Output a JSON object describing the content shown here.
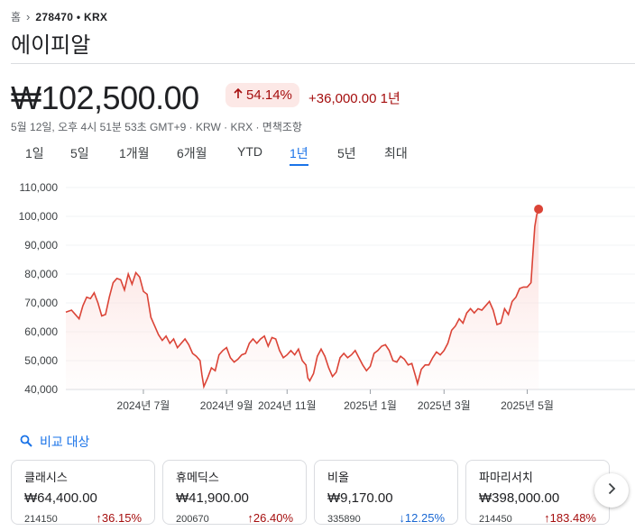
{
  "breadcrumb": {
    "home": "홈",
    "ticker": "278470 • KRX"
  },
  "title": "에이피알",
  "price": "₩102,500.00",
  "change": {
    "percent": "54.14%",
    "absolute": "+36,000.00 1년",
    "direction": "up"
  },
  "timestamp": "5월 12일, 오후 4시 51분 53초 GMT+9 · KRW · KRX · 면책조항",
  "ranges": [
    "1일",
    "5일",
    "1개월",
    "6개월",
    "YTD",
    "1년",
    "5년",
    "최대"
  ],
  "active_range": "1년",
  "colors": {
    "line": "#db4437",
    "up": "#a50e0e",
    "down": "#1967d2",
    "accent": "#1a73e8"
  },
  "chart_data": {
    "type": "area",
    "x_tick_labels": [
      "2024년 7월",
      "2024년 9월",
      "2024년 11월",
      "2025년 1월",
      "2025년 3월",
      "2025년 5월"
    ],
    "y_tick_labels": [
      "40,000",
      "50,000",
      "60,000",
      "70,000",
      "80,000",
      "90,000",
      "100,000",
      "110,000"
    ],
    "ylim": [
      40000,
      110000
    ],
    "x_range": [
      0,
      280
    ],
    "x_ticks": [
      41,
      85,
      117,
      161,
      200,
      244
    ],
    "grid": true,
    "values": [
      [
        0,
        66800
      ],
      [
        3,
        67500
      ],
      [
        5,
        66000
      ],
      [
        7,
        64500
      ],
      [
        9,
        69000
      ],
      [
        11,
        72000
      ],
      [
        13,
        71500
      ],
      [
        15,
        73500
      ],
      [
        17,
        70000
      ],
      [
        19,
        65500
      ],
      [
        21,
        66000
      ],
      [
        23,
        72000
      ],
      [
        25,
        77000
      ],
      [
        27,
        78500
      ],
      [
        29,
        78000
      ],
      [
        31,
        74500
      ],
      [
        33,
        80000
      ],
      [
        35,
        76500
      ],
      [
        37,
        80500
      ],
      [
        39,
        79000
      ],
      [
        41,
        74000
      ],
      [
        43,
        73000
      ],
      [
        45,
        65000
      ],
      [
        47,
        62000
      ],
      [
        49,
        59000
      ],
      [
        51,
        57000
      ],
      [
        53,
        58500
      ],
      [
        55,
        56000
      ],
      [
        57,
        57500
      ],
      [
        59,
        54500
      ],
      [
        61,
        56000
      ],
      [
        63,
        57500
      ],
      [
        65,
        55500
      ],
      [
        67,
        52500
      ],
      [
        69,
        51500
      ],
      [
        71,
        50000
      ],
      [
        72,
        45000
      ],
      [
        73,
        41000
      ],
      [
        75,
        44000
      ],
      [
        77,
        47500
      ],
      [
        79,
        46500
      ],
      [
        81,
        52000
      ],
      [
        83,
        53500
      ],
      [
        85,
        54500
      ],
      [
        87,
        51000
      ],
      [
        89,
        49500
      ],
      [
        91,
        50500
      ],
      [
        93,
        52000
      ],
      [
        95,
        52500
      ],
      [
        97,
        56000
      ],
      [
        99,
        57500
      ],
      [
        101,
        56000
      ],
      [
        103,
        57500
      ],
      [
        105,
        58500
      ],
      [
        107,
        55000
      ],
      [
        109,
        58000
      ],
      [
        111,
        57500
      ],
      [
        113,
        53500
      ],
      [
        115,
        51000
      ],
      [
        117,
        52000
      ],
      [
        119,
        53500
      ],
      [
        121,
        52000
      ],
      [
        123,
        54000
      ],
      [
        125,
        50000
      ],
      [
        127,
        48500
      ],
      [
        128,
        44000
      ],
      [
        129,
        43000
      ],
      [
        131,
        45500
      ],
      [
        133,
        51500
      ],
      [
        135,
        54000
      ],
      [
        137,
        51500
      ],
      [
        139,
        47500
      ],
      [
        141,
        44500
      ],
      [
        143,
        46000
      ],
      [
        145,
        51000
      ],
      [
        147,
        52500
      ],
      [
        149,
        51000
      ],
      [
        151,
        52000
      ],
      [
        153,
        53500
      ],
      [
        155,
        51000
      ],
      [
        157,
        48500
      ],
      [
        159,
        46500
      ],
      [
        161,
        48000
      ],
      [
        163,
        52500
      ],
      [
        165,
        53500
      ],
      [
        167,
        55000
      ],
      [
        169,
        55500
      ],
      [
        171,
        53500
      ],
      [
        173,
        50000
      ],
      [
        175,
        49500
      ],
      [
        177,
        51500
      ],
      [
        179,
        50500
      ],
      [
        181,
        48500
      ],
      [
        183,
        49000
      ],
      [
        185,
        44500
      ],
      [
        186,
        42000
      ],
      [
        188,
        47000
      ],
      [
        190,
        48500
      ],
      [
        192,
        48500
      ],
      [
        194,
        51000
      ],
      [
        196,
        53000
      ],
      [
        198,
        52000
      ],
      [
        200,
        53500
      ],
      [
        202,
        56000
      ],
      [
        204,
        60500
      ],
      [
        206,
        62000
      ],
      [
        208,
        64500
      ],
      [
        210,
        63000
      ],
      [
        212,
        66500
      ],
      [
        214,
        68000
      ],
      [
        216,
        66500
      ],
      [
        218,
        68000
      ],
      [
        220,
        67500
      ],
      [
        222,
        69000
      ],
      [
        224,
        70500
      ],
      [
        226,
        67500
      ],
      [
        228,
        62500
      ],
      [
        230,
        63000
      ],
      [
        232,
        68000
      ],
      [
        234,
        66000
      ],
      [
        236,
        70500
      ],
      [
        238,
        72000
      ],
      [
        240,
        75000
      ],
      [
        242,
        75500
      ],
      [
        244,
        75500
      ],
      [
        246,
        77000
      ],
      [
        247,
        87000
      ],
      [
        248,
        96500
      ],
      [
        249,
        100500
      ],
      [
        250,
        102500
      ]
    ]
  },
  "compare": {
    "heading": "비교 대상",
    "items": [
      {
        "name": "클래시스",
        "price": "₩64,400.00",
        "code": "214150",
        "change": "36.15%",
        "direction": "up"
      },
      {
        "name": "휴메딕스",
        "price": "₩41,900.00",
        "code": "200670",
        "change": "26.40%",
        "direction": "up"
      },
      {
        "name": "비올",
        "price": "₩9,170.00",
        "code": "335890",
        "change": "12.25%",
        "direction": "down"
      },
      {
        "name": "파마리서치",
        "price": "₩398,000.00",
        "code": "214450",
        "change": "183.48%",
        "direction": "up"
      }
    ]
  }
}
